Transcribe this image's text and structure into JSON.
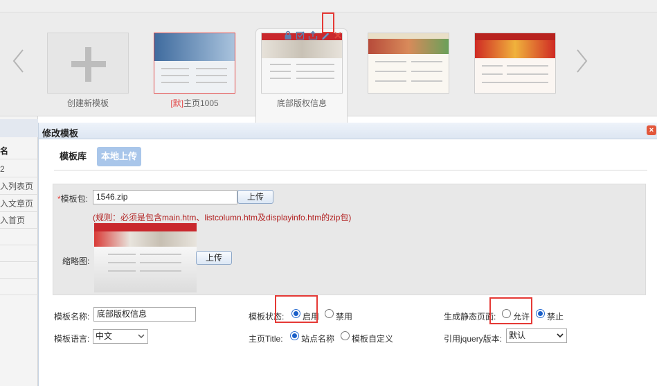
{
  "carousel": {
    "templates": [
      {
        "caption": "创建新模板"
      },
      {
        "badge": "[默]",
        "caption": "主页1005"
      },
      {
        "caption": "底部版权信息"
      },
      {
        "caption": ""
      },
      {
        "caption": ""
      }
    ],
    "tool_icons": [
      "lock-icon",
      "edit-check-icon",
      "export-icon",
      "pencil-icon",
      "delete-icon"
    ]
  },
  "sidebar": {
    "items": [
      "名",
      "2",
      "入列表页",
      "入文章页",
      "入首页",
      "",
      "",
      "",
      ""
    ]
  },
  "dialog": {
    "title": "修改模板",
    "close": "×",
    "tabs": [
      {
        "label": "模板库"
      },
      {
        "label": "本地上传"
      }
    ],
    "upload": {
      "package_label_req": "*",
      "package_label": "模板包:",
      "package_value": "1546.zip",
      "upload_button": "上传",
      "rule": "(规则：必须是包含main.htm、listcolumn.htm及displayinfo.htm的zip包)",
      "thumb_label": "缩略图:",
      "thumb_upload_button": "上传"
    },
    "form": {
      "name_label": "模板名称:",
      "name_value": "底部版权信息",
      "status_label": "模板状态:",
      "status_on": "启用",
      "status_off": "禁用",
      "static_label": "生成静态页面:",
      "static_allow": "允许",
      "static_deny": "禁止",
      "lang_label": "模板语言:",
      "lang_value": "中文",
      "title_label": "主页Title:",
      "title_site": "站点名称",
      "title_custom": "模板自定义",
      "jquery_label": "引用jquery版本:",
      "jquery_value": "默认"
    }
  },
  "colors": {
    "accent": "#a9c6ea",
    "highlight": "#e53935",
    "radio": "#1a5fc8",
    "rule_text": "#b22222"
  }
}
